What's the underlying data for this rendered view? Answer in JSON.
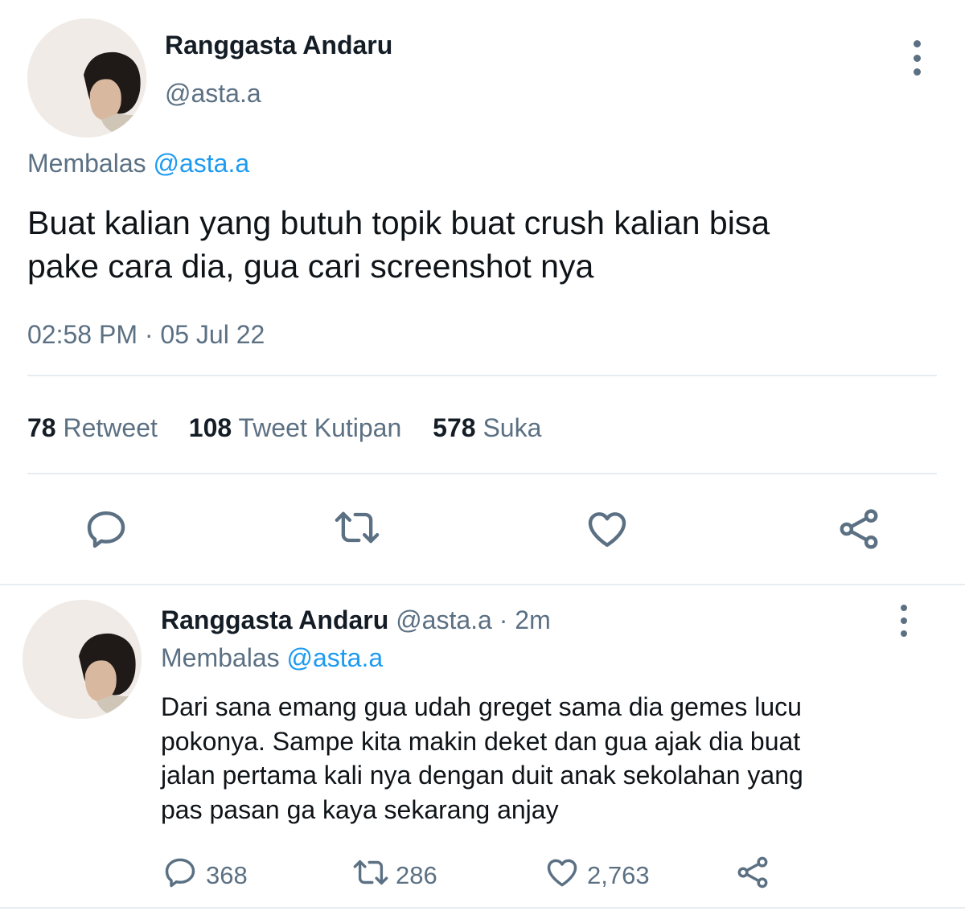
{
  "main_tweet": {
    "author_name": "Ranggasta Andaru",
    "author_handle": "@asta.a",
    "reply_prefix": "Membalas",
    "reply_to": "@asta.a",
    "text_line1": "Buat kalian yang butuh topik buat crush kalian bisa",
    "text_line2": "pake cara dia, gua cari screenshot nya",
    "timestamp": "02:58 PM · 05 Jul 22",
    "stats": {
      "retweets_count": "78",
      "retweets_label": "Retweet",
      "quotes_count": "108",
      "quotes_label": "Tweet Kutipan",
      "likes_count": "578",
      "likes_label": "Suka"
    },
    "actions": [
      "reply-icon",
      "retweet-icon",
      "like-icon",
      "share-icon"
    ]
  },
  "reply_tweet": {
    "author_name": "Ranggasta Andaru",
    "meta": "@asta.a · 2m",
    "reply_prefix": "Membalas",
    "reply_to": "@asta.a",
    "text_lines": [
      "Dari sana emang gua udah greget sama dia gemes lucu",
      "pokonya. Sampe kita makin deket dan gua ajak dia buat",
      "jalan pertama kali nya dengan duit anak sekolahan yang",
      "pas pasan ga kaya sekarang anjay"
    ],
    "reply_count": "368",
    "retweet_count": "286",
    "like_count": "2,763"
  },
  "colors": {
    "text": "#0f1419",
    "muted": "#5b7083",
    "link": "#1d9bf0",
    "divider": "#e6ecf0"
  }
}
